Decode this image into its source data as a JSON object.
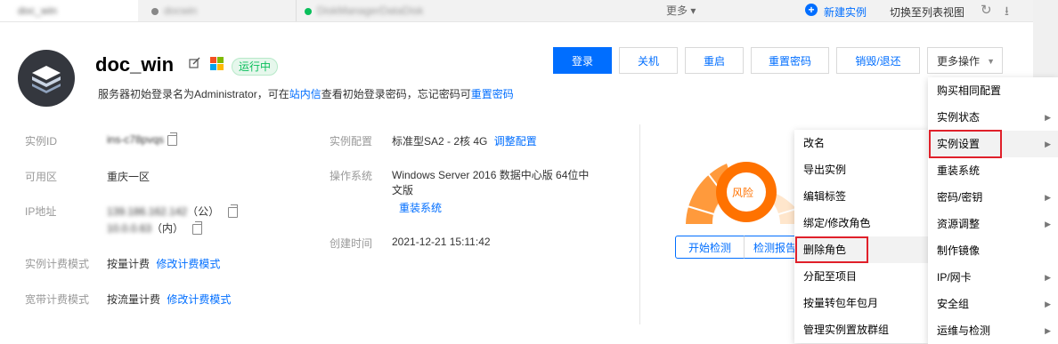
{
  "tabs": [
    {
      "label": "doc_win",
      "active": true
    },
    {
      "label": "docwin",
      "active": false
    },
    {
      "label": "DiskManagerDataDisk",
      "active": false
    }
  ],
  "tabbar": {
    "more": "更多 ▾",
    "new_instance": "新建实例",
    "switch_view": "切换至列表视图"
  },
  "header": {
    "name": "doc_win",
    "status": "运行中",
    "hint_prefix": "服务器初始登录名为Administrator，可在",
    "hint_link1": "站内信",
    "hint_mid": "查看初始登录密码，忘记密码可",
    "hint_link2": "重置密码"
  },
  "actions": {
    "login": "登录",
    "shutdown": "关机",
    "restart": "重启",
    "reset_password": "重置密码",
    "destroy": "销毁/退还",
    "more_ops": "更多操作"
  },
  "info": {
    "instance_id_label": "实例ID",
    "instance_id_value": "ins-c78pvqs",
    "zone_label": "可用区",
    "zone_value": "重庆一区",
    "ip_label": "IP地址",
    "ip_public": "139.186.162.142",
    "ip_public_tag": "（公）",
    "ip_private": "10.0.0.63",
    "ip_private_tag": "（内）",
    "billing_label": "实例计费模式",
    "billing_value": "按量计费",
    "billing_link": "修改计费模式",
    "bandwidth_label": "宽带计费模式",
    "bandwidth_value": "按流量计费",
    "bandwidth_link": "修改计费模式",
    "config_label": "实例配置",
    "config_value": "标准型SA2 - 2核 4G",
    "config_link": "调整配置",
    "os_label": "操作系统",
    "os_value_line1": "Windows Server 2016 数据中心版 64位中",
    "os_value_line2": "文版",
    "os_link": "重装系统",
    "created_label": "创建时间",
    "created_value": "2021-12-21 15:11:42"
  },
  "risk": {
    "label": "风险",
    "start_check": "开始检测",
    "report": "检测报告"
  },
  "colors": {
    "accent": "#006eff",
    "status_green": "#0abf5b",
    "risk_orange": "#ff7200",
    "highlight_red": "#e0202a"
  },
  "more_menu": [
    {
      "label": "购买相同配置",
      "submenu": false
    },
    {
      "label": "实例状态",
      "submenu": true
    },
    {
      "label": "实例设置",
      "submenu": true,
      "highlighted": true
    },
    {
      "label": "重装系统",
      "submenu": false
    },
    {
      "label": "密码/密钥",
      "submenu": true
    },
    {
      "label": "资源调整",
      "submenu": true
    },
    {
      "label": "制作镜像",
      "submenu": false
    },
    {
      "label": "IP/网卡",
      "submenu": true
    },
    {
      "label": "安全组",
      "submenu": true
    },
    {
      "label": "运维与检测",
      "submenu": true
    }
  ],
  "settings_submenu": [
    {
      "label": "改名"
    },
    {
      "label": "导出实例"
    },
    {
      "label": "编辑标签"
    },
    {
      "label": "绑定/修改角色"
    },
    {
      "label": "删除角色",
      "highlighted": true
    },
    {
      "label": "分配至项目"
    },
    {
      "label": "按量转包年包月"
    },
    {
      "label": "管理实例置放群组"
    }
  ],
  "icons": [
    "plus-circle-icon",
    "refresh-icon",
    "download-icon",
    "edit-icon",
    "windows-icon",
    "copy-icon",
    "chevron-down-icon",
    "chevron-right-icon"
  ]
}
